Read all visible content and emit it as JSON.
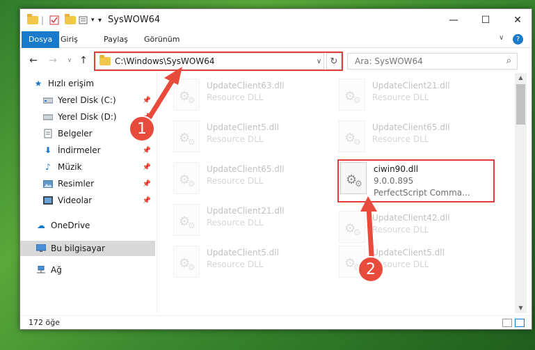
{
  "window": {
    "title": "SysWOW64",
    "controls": {
      "minimize": "—",
      "maximize": "☐",
      "close": "✕"
    }
  },
  "ribbon": {
    "tabs": [
      {
        "label": "Dosya",
        "active": true
      },
      {
        "label": "Giriş"
      },
      {
        "label": "Paylaş"
      },
      {
        "label": "Görünüm"
      }
    ],
    "collapse_icon": "chevron-down-icon",
    "help_icon": "help-icon"
  },
  "nav": {
    "address_path": "C:\\Windows\\SysWOW64",
    "search_placeholder": "Ara: SysWOW64"
  },
  "sidebar": {
    "items": [
      {
        "label": "Hızlı erişim",
        "icon": "star-icon"
      },
      {
        "label": "Yerel Disk (C:)",
        "icon": "drive-icon",
        "pinned": true
      },
      {
        "label": "Yerel Disk (D:)",
        "icon": "drive-icon",
        "pinned": true
      },
      {
        "label": "Belgeler",
        "icon": "documents-icon",
        "pinned": true
      },
      {
        "label": "İndirmeler",
        "icon": "download-icon",
        "pinned": true
      },
      {
        "label": "Müzik",
        "icon": "music-icon",
        "pinned": true
      },
      {
        "label": "Resimler",
        "icon": "pictures-icon",
        "pinned": true
      },
      {
        "label": "Videolar",
        "icon": "videos-icon",
        "pinned": true
      },
      {
        "label": "OneDrive",
        "icon": "cloud-icon"
      },
      {
        "label": "Bu bilgisayar",
        "icon": "computer-icon",
        "selected": true
      },
      {
        "label": "Ağ",
        "icon": "network-icon"
      }
    ]
  },
  "files": [
    {
      "name": "UpdateClient63.dll",
      "sub": "Resource DLL",
      "faded": true
    },
    {
      "name": "UpdateClient21.dll",
      "sub": "Resource DLL",
      "faded": true
    },
    {
      "name": "UpdateClient5.dll",
      "sub": "Resource DLL",
      "faded": true
    },
    {
      "name": "UpdateClient65.dll",
      "sub": "Resource DLL",
      "faded": true
    },
    {
      "name": "UpdateClient65.dll",
      "sub": "Resource DLL",
      "faded": true
    },
    {
      "name": "ciwin90.dll",
      "sub": "9.0.0.895",
      "sub2": "PerfectScript Comma...",
      "faded": false
    },
    {
      "name": "UpdateClient21.dll",
      "sub": "Resource DLL",
      "faded": true
    },
    {
      "name": "UpdateClient42.dll",
      "sub": "Resource DLL",
      "faded": true
    },
    {
      "name": "UpdateClient5.dll",
      "sub": "Resource DLL",
      "faded": true
    },
    {
      "name": "UpdateClient5.dll",
      "sub": "Resource DLL",
      "faded": true
    }
  ],
  "status": {
    "item_count": "172 öğe"
  },
  "annotations": {
    "step1": "1",
    "step2": "2",
    "highlight_color": "#e53b3b"
  }
}
